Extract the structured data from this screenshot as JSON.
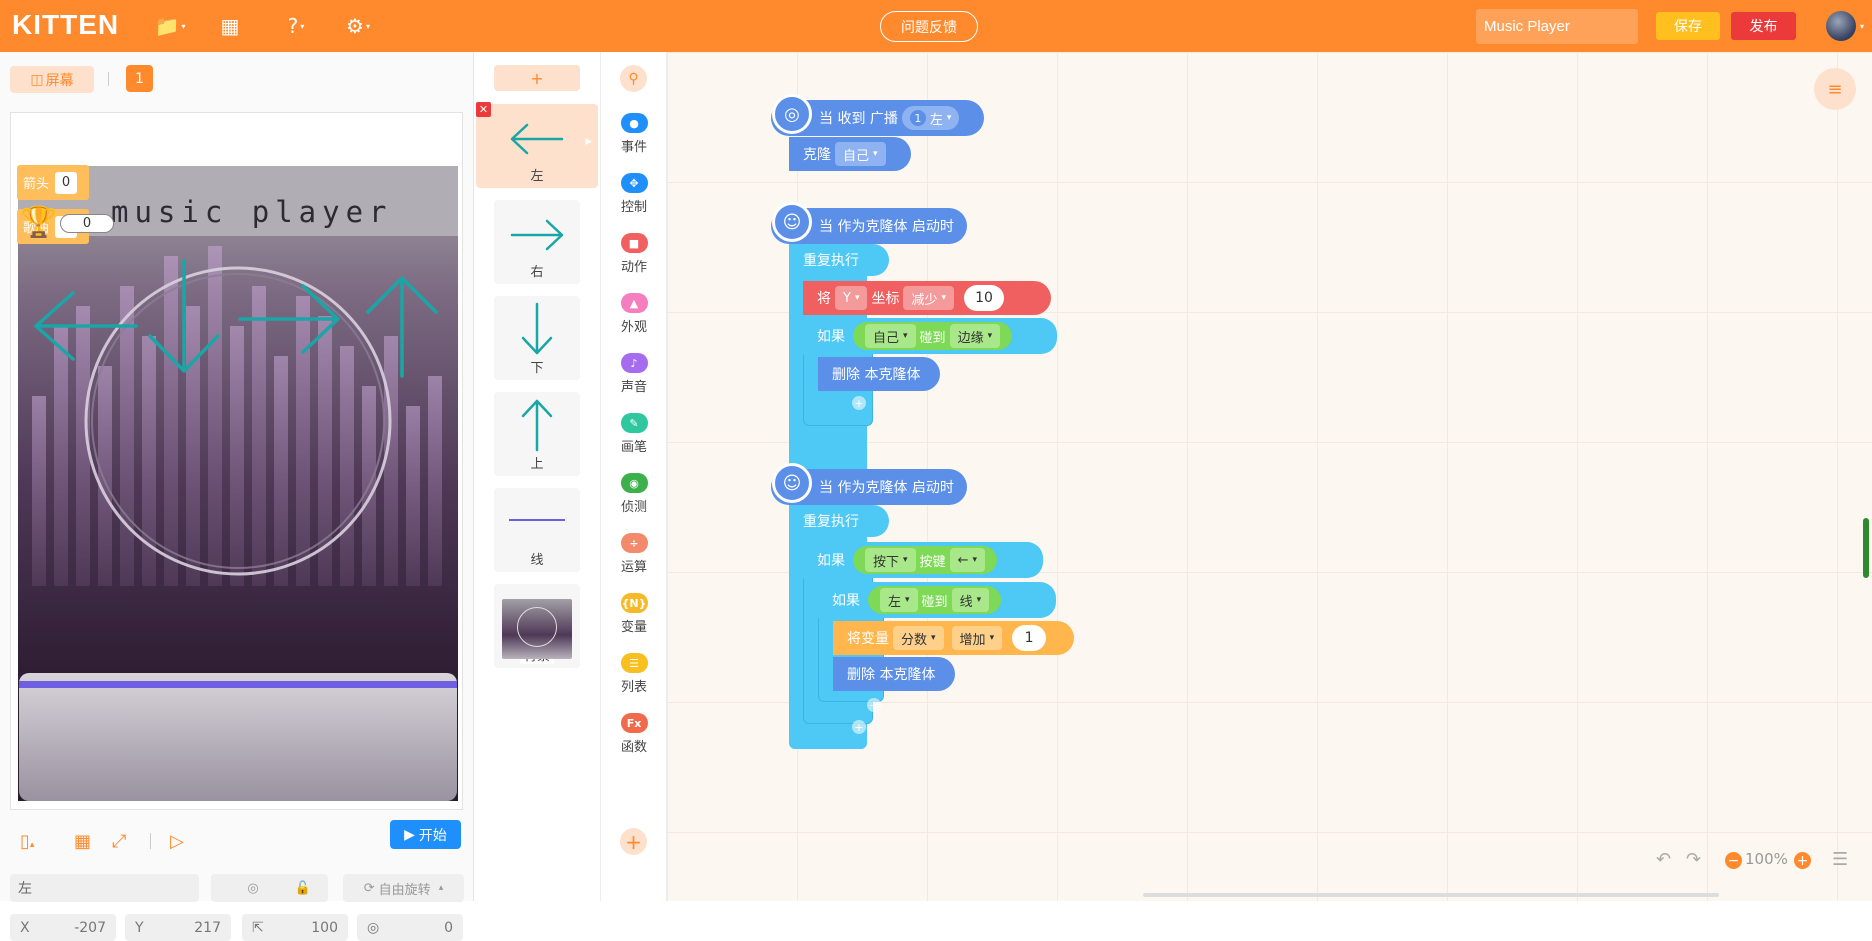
{
  "app": {
    "logo": "KITTEN",
    "feedback_label": "问题反馈",
    "project_name": "Music Player",
    "save_label": "保存",
    "publish_label": "发布"
  },
  "topbar_icons": [
    "folder-icon",
    "backpack-icon",
    "help-icon",
    "settings-icon"
  ],
  "stage": {
    "screen_label": "屏幕",
    "scene_number": "1",
    "canvas_title": "music player",
    "monitors": [
      {
        "label": "箭头",
        "value": "0"
      },
      {
        "label": "歌曲",
        "value": "0"
      }
    ],
    "score_value": "0",
    "start_label": "开始",
    "sprite_name": "左",
    "rotation_label": "自由旋转",
    "x_label": "X",
    "x_value": "-207",
    "y_label": "Y",
    "y_value": "217",
    "size_value": "100",
    "direction_value": "0"
  },
  "sprites": [
    {
      "name": "左",
      "icon": "arrow-left-icon"
    },
    {
      "name": "右",
      "icon": "arrow-right-icon"
    },
    {
      "name": "下",
      "icon": "arrow-down-icon"
    },
    {
      "name": "上",
      "icon": "arrow-up-icon"
    },
    {
      "name": "线",
      "icon": "line-icon"
    },
    {
      "name": "背景",
      "icon": "background-thumb"
    }
  ],
  "add_sprite_label": "+",
  "categories": [
    {
      "label": "事件",
      "color": "#1f8ffb"
    },
    {
      "label": "控制",
      "color": "#1f8ffb"
    },
    {
      "label": "动作",
      "color": "#f06060"
    },
    {
      "label": "外观",
      "color": "#f47ec0"
    },
    {
      "label": "声音",
      "color": "#a56cf0"
    },
    {
      "label": "画笔",
      "color": "#2fc7a0"
    },
    {
      "label": "侦测",
      "color": "#3cb04a"
    },
    {
      "label": "运算",
      "color": "#f28a6b"
    },
    {
      "label": "变量",
      "color": "#f7b928"
    },
    {
      "label": "列表",
      "color": "#f7c020"
    },
    {
      "label": "函数",
      "color": "#f06a4c"
    }
  ],
  "blocks": {
    "s1_hat": "当 收到 广播",
    "s1_hat_pill_num": "1",
    "s1_hat_pill": "左",
    "s1_clone": "克隆",
    "s1_clone_pill": "自己",
    "s2_hat": "当 作为克隆体 启动时",
    "repeat": "重复执行",
    "s2_set": "将",
    "s2_set_pill": "Y",
    "s2_coord": "坐标",
    "s2_change_pill": "减少",
    "s2_value": "10",
    "if": "如果",
    "self_pill": "自己",
    "touch": "碰到",
    "edge_pill": "边缘",
    "delete_clone": "删除 本克隆体",
    "s3_hat": "当 作为克隆体 启动时",
    "press_pill": "按下",
    "key_label": "按键",
    "key_pill": "←",
    "left_pill": "左",
    "line_pill": "线",
    "set_var": "将变量",
    "var_pill": "分数",
    "inc_pill": "增加",
    "var_value": "1"
  },
  "zoom": "100%",
  "colors": {
    "brand": "#ff8a2e",
    "event": "#5b8fe8",
    "control": "#4ec8f4",
    "motion": "#f06060",
    "sensing": "#7ed957",
    "variable": "#ffb64c"
  }
}
